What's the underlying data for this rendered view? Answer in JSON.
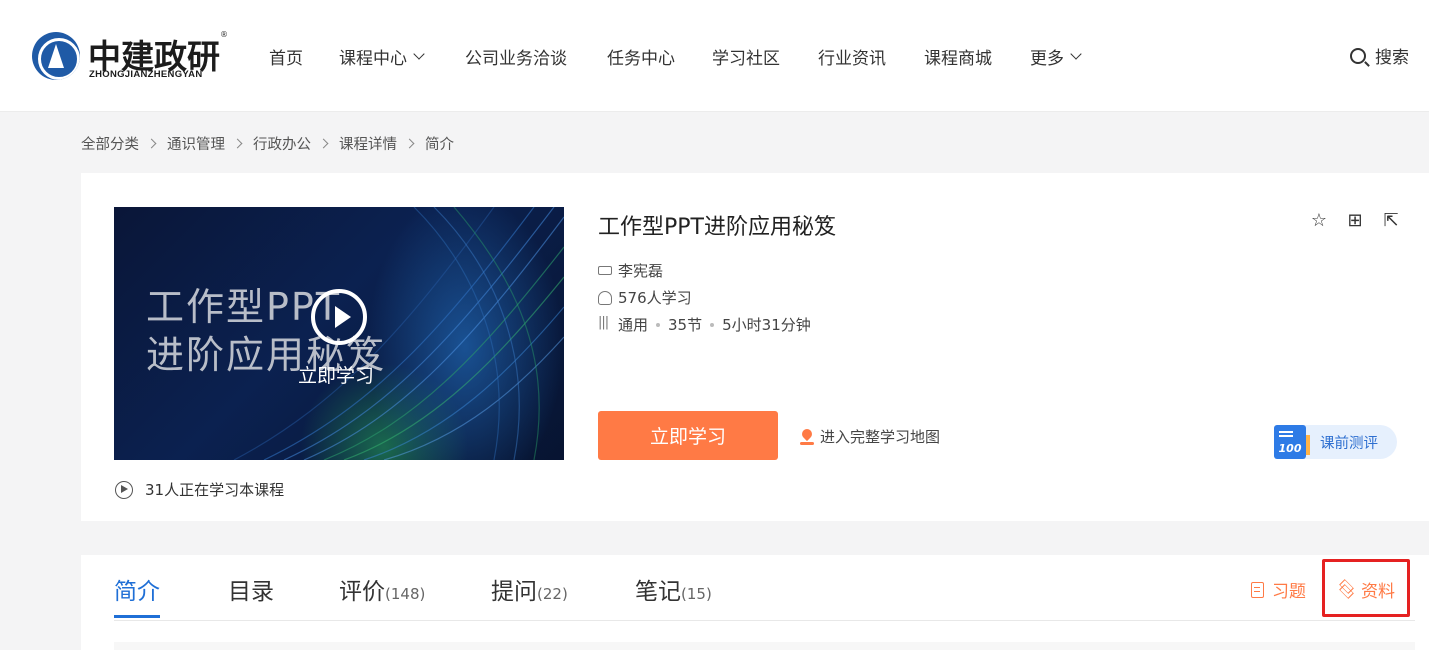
{
  "brand": {
    "name_cn": "中建政研",
    "name_en": "ZHONGJIANZHENGYAN",
    "reg_mark": "®"
  },
  "nav": {
    "items": [
      {
        "label": "首页",
        "dropdown": false
      },
      {
        "label": "课程中心",
        "dropdown": true
      },
      {
        "label": "公司业务洽谈",
        "dropdown": false
      },
      {
        "label": "任务中心",
        "dropdown": false
      },
      {
        "label": "学习社区",
        "dropdown": false
      },
      {
        "label": "行业资讯",
        "dropdown": false
      },
      {
        "label": "课程商城",
        "dropdown": false
      },
      {
        "label": "更多",
        "dropdown": true
      }
    ],
    "search_label": "搜索"
  },
  "breadcrumb": [
    "全部分类",
    "通识管理",
    "行政办公",
    "课程详情",
    "简介"
  ],
  "course": {
    "title": "工作型PPT进阶应用秘笈",
    "cover_title_line1": "工作型PPT",
    "cover_title_line2": "进阶应用秘笈",
    "play_label": "立即学习",
    "teacher": "李宪磊",
    "learners": "576人学习",
    "category": "通用",
    "sections": "35节",
    "duration": "5小时31分钟",
    "learning_now": "31人正在学习本课程",
    "study_button": "立即学习",
    "map_link": "进入完整学习地图",
    "eval_icon_text": "100",
    "eval_button": "课前测评"
  },
  "colors": {
    "accent": "#ff7a45",
    "primary_blue": "#1f6fd6",
    "highlight_red": "#e52121"
  },
  "tabs": [
    {
      "label": "简介",
      "count": "",
      "active": true
    },
    {
      "label": "目录",
      "count": "",
      "active": false
    },
    {
      "label": "评价",
      "count": "(148)",
      "active": false
    },
    {
      "label": "提问",
      "count": "(22)",
      "active": false
    },
    {
      "label": "笔记",
      "count": "(15)",
      "active": false
    }
  ],
  "tab_actions": {
    "exercises": "习题",
    "materials": "资料"
  }
}
